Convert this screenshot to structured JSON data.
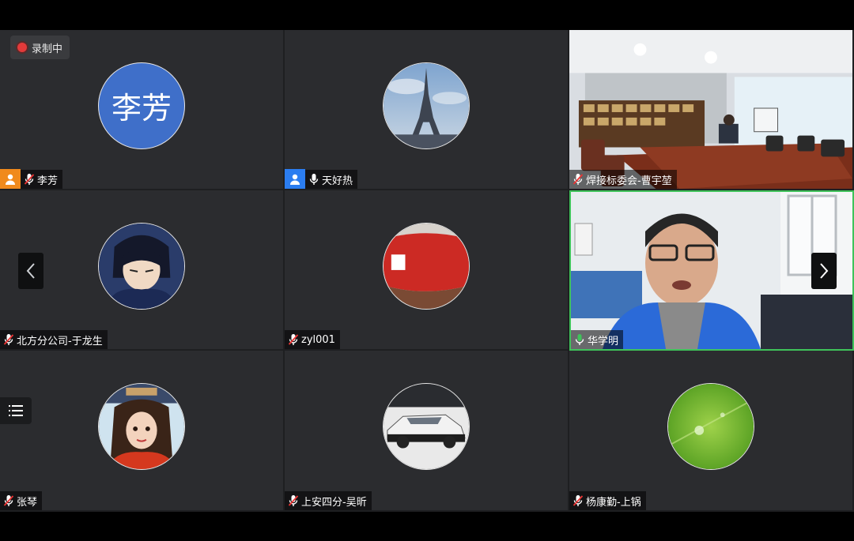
{
  "recording": {
    "label": "录制中"
  },
  "participants": [
    {
      "name": "李芳",
      "avatar_text": "李芳",
      "mic": "muted",
      "role": "host"
    },
    {
      "name": "天好热",
      "mic": "on",
      "role": "cohost"
    },
    {
      "name": "焊接标委会-曹宇堃",
      "mic": "muted",
      "video": true
    },
    {
      "name": "北方分公司-于龙生",
      "mic": "muted"
    },
    {
      "name": "zyl001",
      "mic": "muted"
    },
    {
      "name": "华学明",
      "mic": "speaking",
      "video": true,
      "active": true
    },
    {
      "name": "张琴",
      "mic": "muted"
    },
    {
      "name": "上安四分-吴昕",
      "mic": "muted"
    },
    {
      "name": "杨康勤-上锅",
      "mic": "muted"
    }
  ],
  "colors": {
    "active_border": "#3fc35a",
    "host_badge": "#f08a1c",
    "cohost_badge": "#2b7df0",
    "record_dot": "#e23a3a"
  }
}
